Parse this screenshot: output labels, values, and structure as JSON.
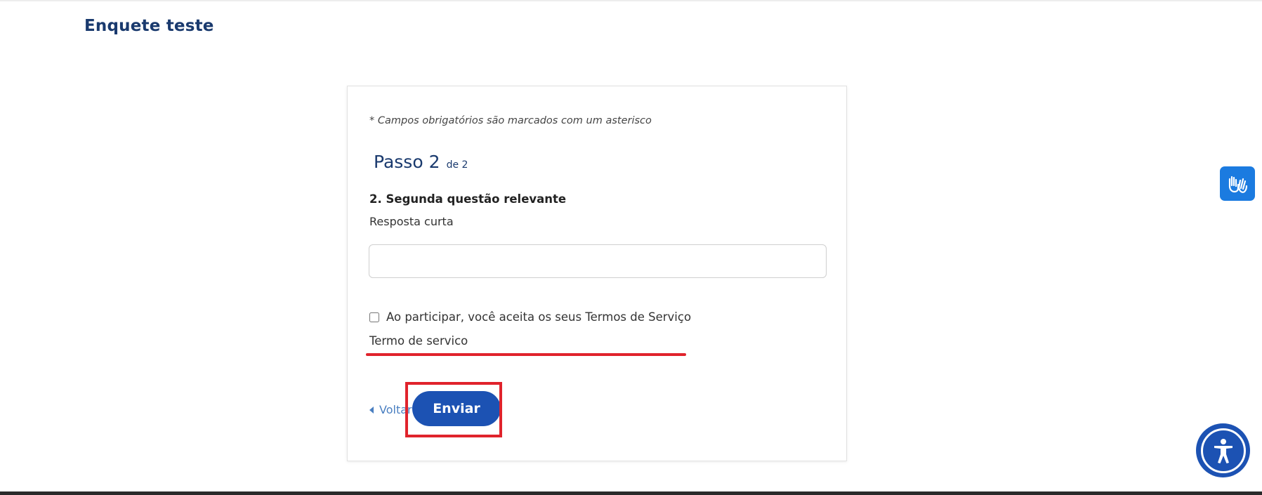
{
  "page": {
    "title": "Enquete teste"
  },
  "form": {
    "required_note": "* Campos obrigatórios são marcados com um asterisco",
    "step": {
      "label": "Passo 2",
      "of": "de 2"
    },
    "question": {
      "title": "2. Segunda questão relevante",
      "type_label": "Resposta curta",
      "value": "",
      "placeholder": ""
    },
    "terms": {
      "checkbox_label": "Ao participar, você aceita os seus Termos de Serviço",
      "checked": false,
      "link_text": "Termo de servico"
    },
    "back_label": "Voltar",
    "submit_label": "Enviar"
  },
  "widgets": {
    "vlibras_icon": "sign-language-hands-icon",
    "accessibility_icon": "accessibility-person-icon"
  },
  "colors": {
    "primary": "#1c52b3",
    "title": "#1a3a6e",
    "link": "#4a7fc1",
    "annotation": "#e0232c",
    "vlibras": "#1b7be0"
  }
}
